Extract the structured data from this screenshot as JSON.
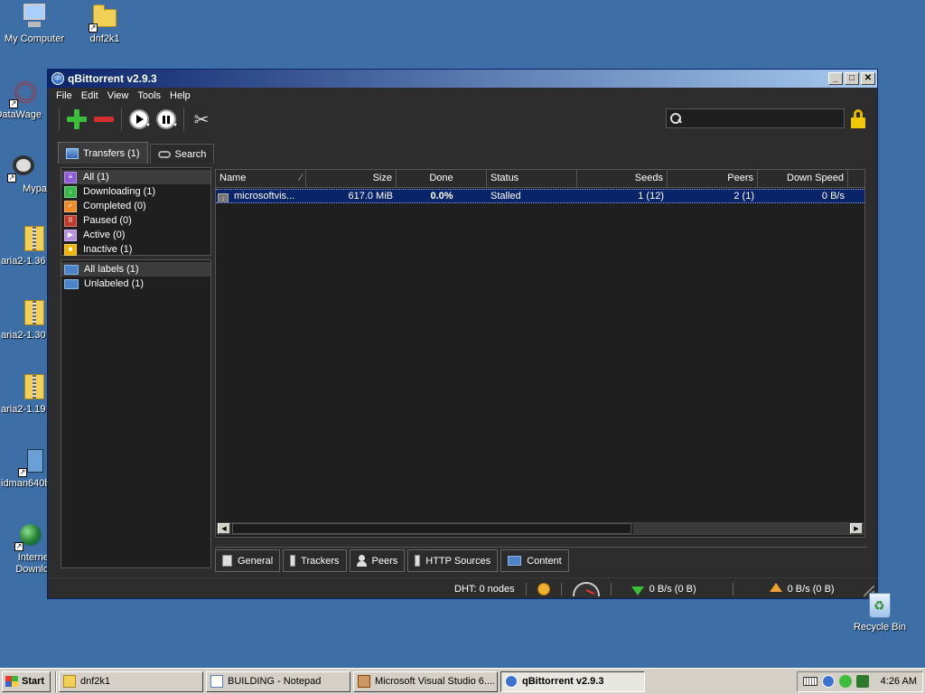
{
  "desktop": {
    "icons": [
      {
        "label": "My Computer"
      },
      {
        "label": "dnf2k1"
      },
      {
        "label": "DataWage"
      },
      {
        "label": "Mypa"
      },
      {
        "label": "aria2-1.36"
      },
      {
        "label": "aria2-1.30"
      },
      {
        "label": "aria2-1.19"
      },
      {
        "label": "idman640b"
      },
      {
        "label": "Interne"
      },
      {
        "label": "Downlo"
      }
    ],
    "recycle_bin": "Recycle Bin"
  },
  "window": {
    "title": "qBittorrent v2.9.3",
    "icon_text": "qb",
    "controls": {
      "minimize": "_",
      "maximize": "□",
      "close": "✕"
    }
  },
  "menu": [
    "File",
    "Edit",
    "View",
    "Tools",
    "Help"
  ],
  "search": {
    "placeholder": "",
    "value": ""
  },
  "tabs": {
    "transfers": "Transfers (1)",
    "search": "Search"
  },
  "status_filters": [
    {
      "label": "All (1)",
      "icon": "all-icon",
      "color": "#8e5bd6",
      "selected": true
    },
    {
      "label": "Downloading (1)",
      "icon": "downloading-icon",
      "color": "#39b54a"
    },
    {
      "label": "Completed (0)",
      "icon": "completed-icon",
      "color": "#f08a24"
    },
    {
      "label": "Paused (0)",
      "icon": "paused-icon",
      "color": "#c0392b"
    },
    {
      "label": "Active (0)",
      "icon": "active-icon",
      "color": "#b88fdd"
    },
    {
      "label": "Inactive (1)",
      "icon": "inactive-icon",
      "color": "#f2b400"
    }
  ],
  "labels": [
    {
      "label": "All labels (1)",
      "selected": true
    },
    {
      "label": "Unlabeled (1)"
    }
  ],
  "grid": {
    "columns": [
      "Name",
      "Size",
      "Done",
      "Status",
      "Seeds",
      "Peers",
      "Down Speed"
    ],
    "rows": [
      {
        "name": "microsoftvis...",
        "size": "617.0 MiB",
        "done": "0.0%",
        "status": "Stalled",
        "seeds": "1 (12)",
        "peers": "2 (1)",
        "down_speed": "0 B/s"
      }
    ]
  },
  "bottom_tabs": [
    "General",
    "Trackers",
    "Peers",
    "HTTP Sources",
    "Content"
  ],
  "statusbar": {
    "dht": "DHT: 0 nodes",
    "download": "0 B/s (0 B)",
    "upload": "0 B/s (0 B)"
  },
  "taskbar": {
    "start": "Start",
    "tasks": [
      {
        "label": "dnf2k1",
        "icon": "folder-icon"
      },
      {
        "label": "BUILDING - Notepad",
        "icon": "notepad-icon"
      },
      {
        "label": "Microsoft Visual Studio 6....",
        "icon": "visual-studio-icon"
      },
      {
        "label": "qBittorrent v2.9.3",
        "icon": "qbittorrent-icon",
        "active": true
      }
    ],
    "clock": "4:26 AM"
  },
  "colors": {
    "desktop": "#3d6ea5",
    "window_bg": "#2d2d2d",
    "selection": "#0a246a",
    "titlebar_start": "#0a246a",
    "titlebar_end": "#a6caf0"
  }
}
